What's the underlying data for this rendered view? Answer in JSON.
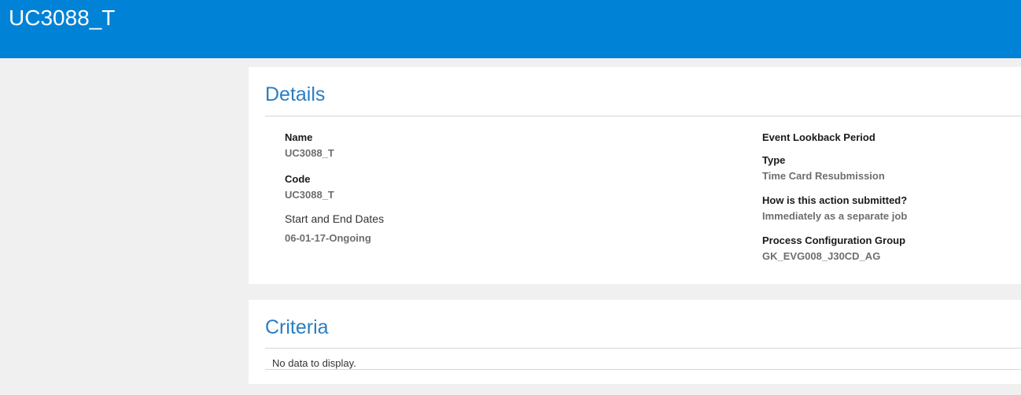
{
  "header": {
    "title": "UC3088_T"
  },
  "details": {
    "heading": "Details",
    "left": {
      "name_label": "Name",
      "name_value": "UC3088_T",
      "code_label": "Code",
      "code_value": "UC3088_T",
      "dates_label": "Start and End Dates",
      "dates_value": "06-01-17-Ongoing"
    },
    "right": {
      "lookback_label": "Event Lookback Period",
      "type_label": "Type",
      "type_value": "Time Card Resubmission",
      "submission_label": "How is this action submitted?",
      "submission_value": "Immediately as a separate job",
      "group_label": "Process Configuration Group",
      "group_value": "GK_EVG008_J30CD_AG"
    }
  },
  "criteria": {
    "heading": "Criteria",
    "empty_text": "No data to display."
  },
  "colors": {
    "header_bg": "#0082d6",
    "heading_text": "#2a7ec4",
    "page_bg": "#f0f0f0"
  }
}
